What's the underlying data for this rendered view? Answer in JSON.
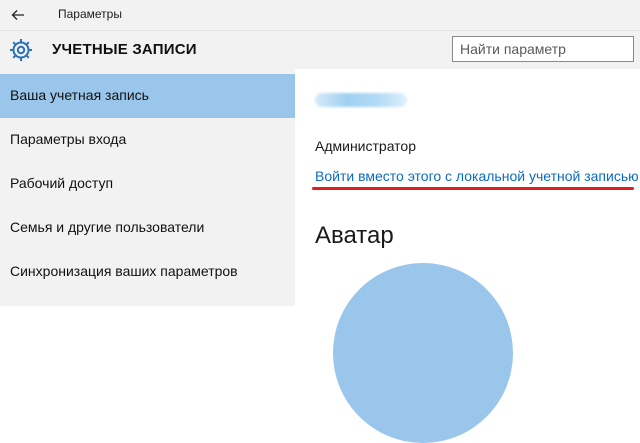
{
  "window": {
    "title": "Параметры"
  },
  "header": {
    "section_title": "УЧЕТНЫЕ ЗАПИСИ",
    "search_placeholder": "Найти параметр"
  },
  "sidebar": {
    "items": [
      {
        "label": "Ваша учетная запись",
        "active": true
      },
      {
        "label": "Параметры входа"
      },
      {
        "label": "Рабочий доступ"
      },
      {
        "label": "Семья и другие пользователи"
      },
      {
        "label": "Синхронизация ваших параметров"
      }
    ]
  },
  "main": {
    "role": "Администратор",
    "switch_link": "Войти вместо этого с локальной учетной записью",
    "avatar_heading": "Аватар"
  },
  "colors": {
    "accent": "#99c6ea",
    "link": "#0b6cc0",
    "annotation": "#e01e1e"
  }
}
